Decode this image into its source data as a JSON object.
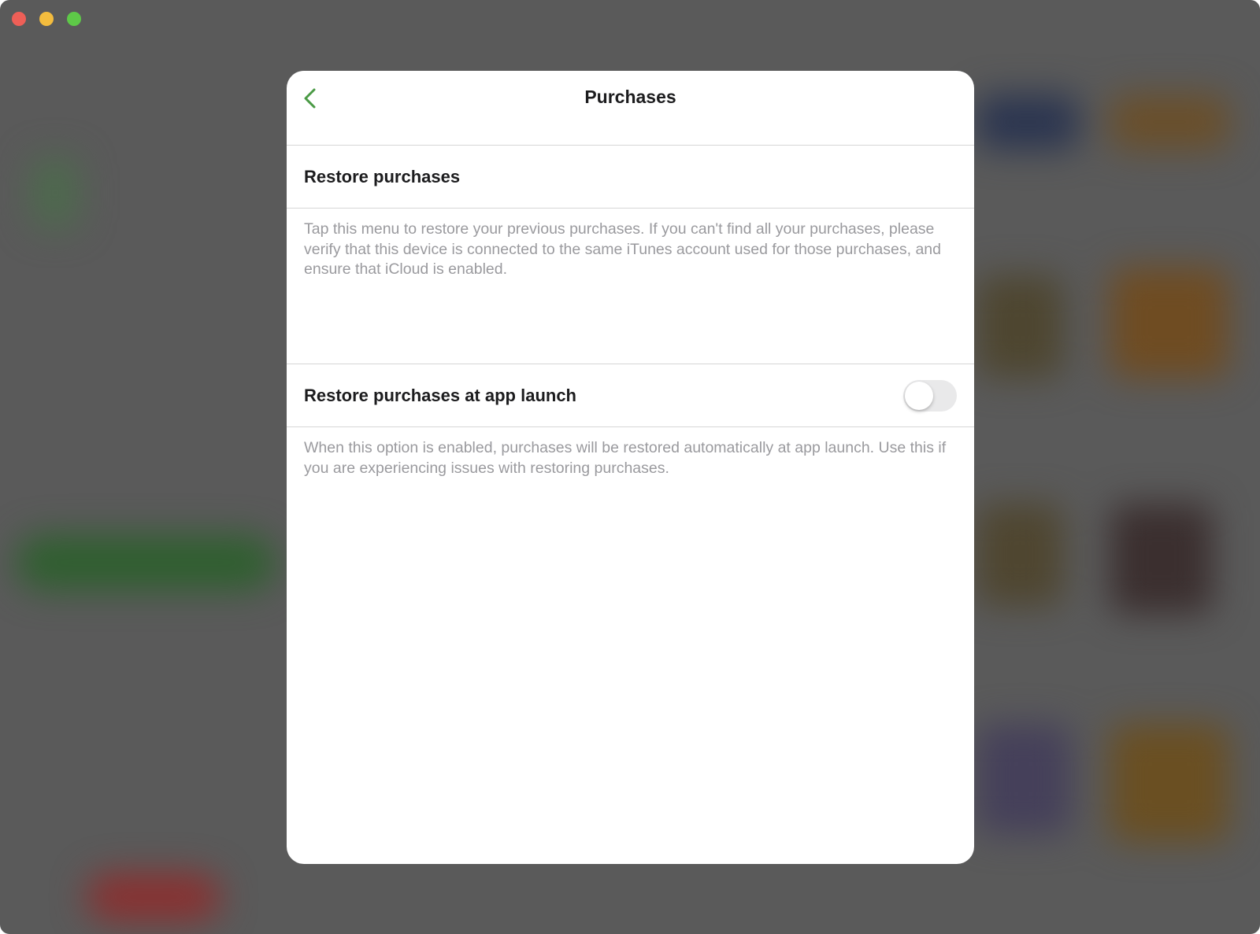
{
  "window": {
    "controls": [
      "close",
      "minimize",
      "maximize"
    ]
  },
  "modal": {
    "title": "Purchases",
    "back_icon": "chevron-left-icon",
    "accent_color": "#4a9a45",
    "restore_row": {
      "label": "Restore purchases"
    },
    "restore_description": "Tap this menu to restore your previous purchases. If you can't find all your purchases, please verify that this device is connected to the same iTunes account used for those purchases, and ensure that iCloud is enabled.",
    "launch_row": {
      "label": "Restore purchases at app launch",
      "toggle_on": false
    },
    "launch_description": "When this option is enabled, purchases will be restored automatically at app launch. Use this if you are experiencing issues with restoring purchases."
  }
}
